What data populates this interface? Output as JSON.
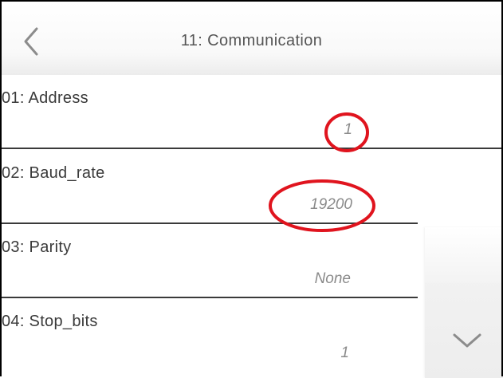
{
  "header": {
    "title": "11: Communication",
    "back_icon": "chevron-left-icon"
  },
  "settings": [
    {
      "label": "01: Address",
      "value": "1"
    },
    {
      "label": "02: Baud_rate",
      "value": "19200"
    },
    {
      "label": "03: Parity",
      "value": "None"
    },
    {
      "label": "04: Stop_bits",
      "value": "1"
    }
  ],
  "scroll": {
    "down_icon": "chevron-down-icon"
  },
  "annotations": {
    "highlighted_values": [
      "1",
      "19200"
    ],
    "highlight_color": "#e0141e"
  },
  "colors": {
    "text": "#3a3a3a",
    "value_text": "#8a8a8a",
    "divider": "#3a3a3a",
    "frame": "#000000"
  }
}
